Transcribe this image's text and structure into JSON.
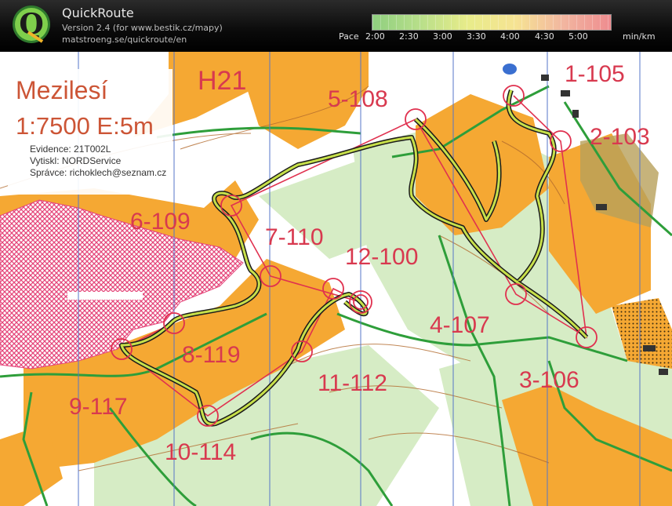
{
  "app": {
    "title": "QuickRoute",
    "version": "Version 2.4  (for www.bestik.cz/mapy)",
    "url": "matstroeng.se/quickroute/en"
  },
  "pace_scale": {
    "label": "Pace",
    "unit": "min/km",
    "ticks": [
      "2:00",
      "2:30",
      "3:00",
      "3:30",
      "4:00",
      "4:30",
      "5:00"
    ],
    "colors": [
      "#8fcf7f",
      "#b8df8a",
      "#e8ec8a",
      "#f6e393",
      "#f2b6a0",
      "#ee8c8f"
    ]
  },
  "map": {
    "title": "Mezilesí",
    "scale": "1:7500 E:5m",
    "category": "H21",
    "evidence": "Evidence: 21T002L",
    "printed_by": "Vytiskl: NORDService",
    "admin": "Správce: richoklech@seznam.cz",
    "controls": [
      "1-105",
      "2-103",
      "3-106",
      "4-107",
      "5-108",
      "6-109",
      "7-110",
      "8-119",
      "9-117",
      "10-114",
      "11-112",
      "12-100"
    ],
    "colors": {
      "forest_open": "#f5a833",
      "vegetation": "#d6ecc5",
      "course": "#e0314f",
      "route_line": "#c7e04a",
      "paths": "#2e9e3a",
      "north_lines": "#5576c8",
      "out_of_bounds": "#e5467a"
    }
  }
}
